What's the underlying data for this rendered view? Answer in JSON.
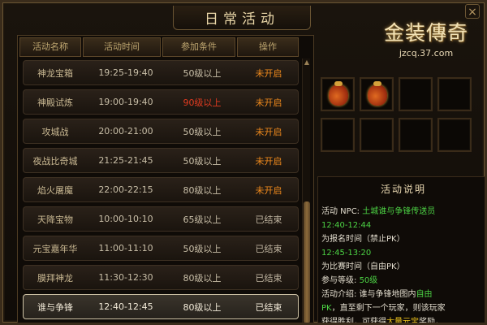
{
  "window": {
    "title": "日常活动",
    "close_symbol": "×"
  },
  "table": {
    "headers": [
      "活动名称",
      "活动时间",
      "参加条件",
      "操作"
    ],
    "rows": [
      {
        "name": "神龙宝箱",
        "time": "19:25-19:40",
        "condition": "50级以上",
        "action": "未开启",
        "status": "pending"
      },
      {
        "name": "神殿试炼",
        "time": "19:00-19:40",
        "condition": "90级以上",
        "action": "未开启",
        "status": "pending",
        "condition_warning": true
      },
      {
        "name": "攻城战",
        "time": "20:00-21:00",
        "condition": "50级以上",
        "action": "未开启",
        "status": "pending"
      },
      {
        "name": "夜战比奇城",
        "time": "21:25-21:45",
        "condition": "50级以上",
        "action": "未开启",
        "status": "pending"
      },
      {
        "name": "焰火屠魔",
        "time": "22:00-22:15",
        "condition": "80级以上",
        "action": "未开启",
        "status": "pending"
      },
      {
        "name": "天降宝物",
        "time": "10:00-10:10",
        "condition": "65级以上",
        "action": "已结束",
        "status": "done"
      },
      {
        "name": "元宝嘉年华",
        "time": "11:00-11:10",
        "condition": "50级以上",
        "action": "已结束",
        "status": "done"
      },
      {
        "name": "膜拜神龙",
        "time": "11:30-12:30",
        "condition": "80级以上",
        "action": "已结束",
        "status": "done"
      },
      {
        "name": "谁与争锋",
        "time": "12:40-12:45",
        "condition": "80级以上",
        "action": "已结束",
        "status": "done",
        "selected": true
      }
    ]
  },
  "logo": {
    "text": "金装傳奇",
    "url": "jzcq.37.com"
  },
  "reward_slots": [
    {
      "item": "reward-bag-icon"
    },
    {
      "item": "reward-bag-icon"
    },
    {
      "item": ""
    },
    {
      "item": ""
    },
    {
      "item": ""
    },
    {
      "item": ""
    },
    {
      "item": ""
    },
    {
      "item": ""
    }
  ],
  "info": {
    "title": "活动说明",
    "line1_label": "活动 NPC: ",
    "line1_value": "土城谁与争锋传送员",
    "line2": "12:40-12:44",
    "line3": "为报名时间（禁止PK）",
    "line4": "12:45-13:20",
    "line5": "为比赛时间（自由PK）",
    "line6_label": "参与等级: ",
    "line6_value": "50级",
    "line7_a": "活动介绍: 谁与争锋地图内",
    "line7_b": "自由",
    "line8_a": "PK",
    "line8_b": "，直至剩下一个玩家，则该玩家",
    "line9_a": "获得胜利，可获得",
    "line9_b": "大量元宝",
    "line9_c": "奖励，"
  },
  "colors": {
    "accent_gold": "#bda56f",
    "pending_orange": "#f08a1c",
    "warning_red": "#e23b20",
    "info_green": "#4cd244",
    "info_yellow": "#f0c51c"
  }
}
